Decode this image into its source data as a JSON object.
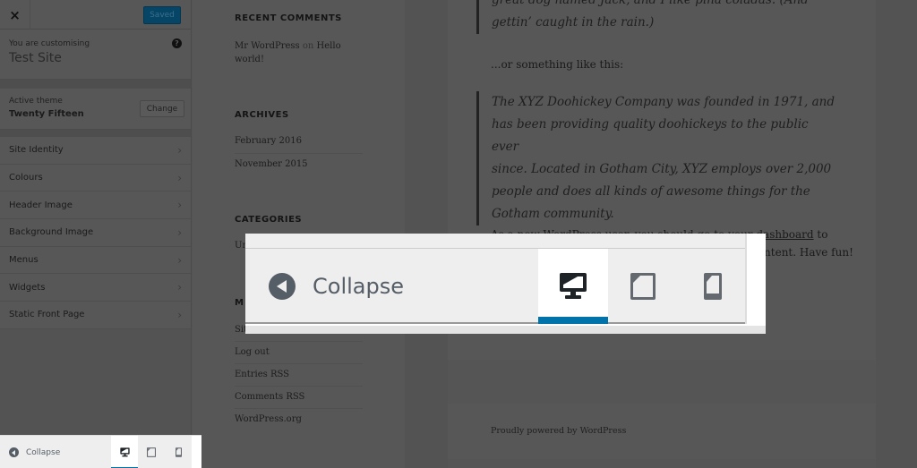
{
  "customizer": {
    "close_label": "×",
    "save_button": "Saved",
    "info": {
      "label": "You are customising",
      "site": "Test Site",
      "help_icon": "?"
    },
    "theme": {
      "label": "Active theme",
      "name": "Twenty Fifteen",
      "change_button": "Change"
    },
    "sections": [
      {
        "label": "Site Identity"
      },
      {
        "label": "Colours"
      },
      {
        "label": "Header Image"
      },
      {
        "label": "Background Image"
      },
      {
        "label": "Menus"
      },
      {
        "label": "Widgets"
      },
      {
        "label": "Static Front Page"
      }
    ],
    "footer": {
      "collapse_label": "Collapse",
      "devices": [
        {
          "name": "desktop",
          "icon": "desktop-icon",
          "active": true
        },
        {
          "name": "tablet",
          "icon": "tablet-icon",
          "active": false
        },
        {
          "name": "mobile",
          "icon": "mobile-icon",
          "active": false
        }
      ]
    }
  },
  "widgets": {
    "recent_comments": {
      "title": "RECENT COMMENTS",
      "author": "Mr WordPress",
      "on": "on",
      "post_line1": "Hello",
      "post_line2": "world!"
    },
    "archives": {
      "title": "ARCHIVES",
      "items": [
        "February 2016",
        "November 2015"
      ]
    },
    "categories": {
      "title": "CATEGORIES",
      "partial_item": "Un"
    },
    "meta": {
      "title_partial": "M",
      "partial_first": "Sit",
      "items": [
        "Log out",
        "Entries RSS",
        "Comments RSS",
        "WordPress.org"
      ]
    }
  },
  "content": {
    "quote1_line1": "great dog named Jack, and I like piña coladas. (And",
    "quote1_line2": "gettin’ caught in the rain.)",
    "para1": "...or something like this:",
    "quote2": [
      "The XYZ Doohickey Company was founded in 1971, and",
      "has been providing quality doohickeys to the public ever",
      "since. Located in Gotham City, XYZ employs over 2,000",
      "people and does all kinds of awesome things for the",
      "Gotham community."
    ],
    "para2_line1_start": "As a new WordPress user, you should go to your ",
    "para2_link": "dashboard",
    "para2_line1_end": " to",
    "para2_line2": "delete this page and create new pages for your content. Have fun!",
    "footer": "Proudly powered by WordPress"
  },
  "callout": {
    "collapse_label": "Collapse",
    "devices": [
      {
        "name": "desktop",
        "active": true
      },
      {
        "name": "tablet",
        "active": false
      },
      {
        "name": "mobile",
        "active": false
      }
    ],
    "accent_color": "#0073aa"
  }
}
